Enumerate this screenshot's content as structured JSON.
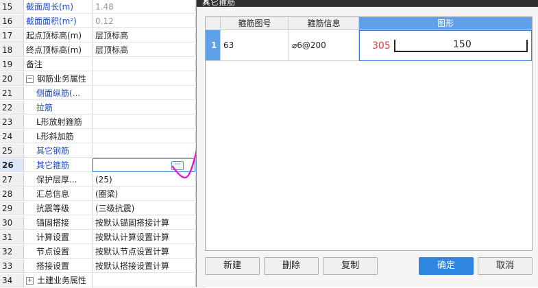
{
  "grid": {
    "rows": [
      {
        "num": "15",
        "name": "截面周长(m)",
        "value": "1.48",
        "name_style": "blue",
        "value_style": "gray",
        "check": true
      },
      {
        "num": "16",
        "name": "截面面积(m²)",
        "value": "0.12",
        "name_style": "blue",
        "value_style": "gray",
        "check": true
      },
      {
        "num": "17",
        "name": "起点顶标高(m)",
        "value": "层顶标高",
        "name_style": "",
        "value_style": "",
        "check": true
      },
      {
        "num": "18",
        "name": "终点顶标高(m)",
        "value": "层顶标高",
        "name_style": "",
        "value_style": "",
        "check": true
      },
      {
        "num": "19",
        "name": "备注",
        "value": "",
        "name_style": "",
        "value_style": "",
        "check": true
      },
      {
        "num": "20",
        "name": "钢筋业务属性",
        "value": "",
        "name_style": "",
        "value_style": "",
        "check": false,
        "expander": "−"
      },
      {
        "num": "21",
        "name": "侧面纵筋(...",
        "value": "",
        "name_style": "blue",
        "value_style": "",
        "check": true,
        "child": true
      },
      {
        "num": "22",
        "name": "拉筋",
        "value": "",
        "name_style": "blue",
        "value_style": "",
        "check": true,
        "child": true
      },
      {
        "num": "23",
        "name": "L形放射箍筋",
        "value": "",
        "name_style": "",
        "value_style": "",
        "check": true,
        "child": true
      },
      {
        "num": "24",
        "name": "L形斜加筋",
        "value": "",
        "name_style": "",
        "value_style": "",
        "check": true,
        "child": true
      },
      {
        "num": "25",
        "name": "其它钢筋",
        "value": "",
        "name_style": "blue",
        "value_style": "",
        "check": true,
        "child": true
      },
      {
        "num": "26",
        "name": "其它箍筋",
        "value": "",
        "name_style": "blue",
        "value_style": "",
        "check": true,
        "child": true,
        "selected": true
      },
      {
        "num": "27",
        "name": "保护层厚...",
        "value": "(25)",
        "name_style": "",
        "value_style": "",
        "check": true,
        "child": true
      },
      {
        "num": "28",
        "name": "汇总信息",
        "value": "(圈梁)",
        "name_style": "",
        "value_style": "",
        "check": true,
        "child": true
      },
      {
        "num": "29",
        "name": "抗震等级",
        "value": "(三级抗震)",
        "name_style": "",
        "value_style": "",
        "check": true,
        "child": true
      },
      {
        "num": "30",
        "name": "锚固搭接",
        "value": "按默认锚固搭接计算",
        "name_style": "",
        "value_style": "",
        "check": false,
        "child": true
      },
      {
        "num": "31",
        "name": "计算设置",
        "value": "按默认计算设置计算",
        "name_style": "",
        "value_style": "",
        "check": false,
        "child": true
      },
      {
        "num": "32",
        "name": "节点设置",
        "value": "按默认节点设置计算",
        "name_style": "",
        "value_style": "",
        "check": false,
        "child": true
      },
      {
        "num": "33",
        "name": "搭接设置",
        "value": "按默认搭接设置计算",
        "name_style": "",
        "value_style": "",
        "check": false,
        "child": true
      },
      {
        "num": "34",
        "name": "土建业务属性",
        "value": "",
        "name_style": "",
        "value_style": "",
        "check": false,
        "expander": "+"
      }
    ],
    "edit_button_label": "···"
  },
  "dialog": {
    "title": "其它箍筋",
    "close": "×",
    "table": {
      "headers": [
        "箍筋图号",
        "箍筋信息",
        "图形"
      ],
      "row": {
        "index": "1",
        "code": "63",
        "info": "⌀6@200",
        "shape_left": "305",
        "shape_right": "150"
      }
    },
    "buttons": {
      "new": "新建",
      "delete": "删除",
      "copy": "复制",
      "ok": "确定",
      "cancel": "取消"
    }
  },
  "colors": {
    "accent": "#2f86e0",
    "link": "#1f49c4",
    "annotation": "#e020c0",
    "shape_dim": "#e23b3b"
  }
}
